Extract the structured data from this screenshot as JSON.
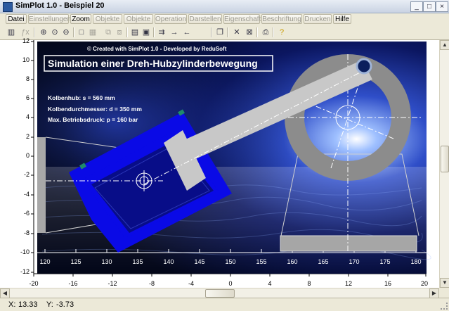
{
  "window": {
    "title": "SimPlot 1.0 - Beispiel 20"
  },
  "menu": {
    "items": [
      {
        "label": "Datei",
        "enabled": true
      },
      {
        "label": "Einstellungen",
        "enabled": false
      },
      {
        "label": "Zoom",
        "enabled": true
      },
      {
        "label": "Objekte I",
        "enabled": false
      },
      {
        "label": "Objekte II",
        "enabled": false
      },
      {
        "label": "Operation",
        "enabled": false
      },
      {
        "label": "Darstellen",
        "enabled": false
      },
      {
        "label": "Eigenschaft",
        "enabled": false
      },
      {
        "label": "Beschriftung",
        "enabled": false
      },
      {
        "label": "Drucken",
        "enabled": false
      },
      {
        "label": "Hilfe",
        "enabled": true
      }
    ]
  },
  "toolbar": {
    "icons": [
      "calculator-icon",
      "function-icon",
      "zoom-in-icon",
      "zoom-area-icon",
      "zoom-out-icon",
      "rectangle-icon",
      "grid-icon",
      "copy-object-icon",
      "paste-object-icon",
      "table-icon",
      "image-icon",
      "export-icon",
      "arrow-right-icon",
      "arrow-left-icon",
      "pages-icon",
      "delete-icon",
      "delete-all-icon",
      "print-icon",
      "help-icon"
    ]
  },
  "plot": {
    "y_ticks": [
      "12",
      "10",
      "8",
      "6",
      "4",
      "2",
      "0",
      "-2",
      "-4",
      "-6",
      "-8",
      "-10",
      "-12"
    ],
    "x_ticks": [
      "-20",
      "-16",
      "-12",
      "-8",
      "-4",
      "0",
      "4",
      "8",
      "12",
      "16",
      "20"
    ],
    "inner_x_ticks": [
      "120",
      "125",
      "130",
      "135",
      "140",
      "145",
      "150",
      "155",
      "160",
      "165",
      "170",
      "175",
      "180"
    ],
    "credit": "© Created with SimPlot 1.0 - Developed by ReduSoft",
    "heading": "Simulation einer Dreh-Hubzylinderbewegung",
    "specs": [
      "Kolbenhub: s = 560 mm",
      "Kolbendurchmesser: d = 350 mm",
      "Max. Betriebsdruck: p = 160 bar"
    ],
    "colors": {
      "cylinder": "#0a0ae6",
      "piston": "#c8c8c8",
      "wheel": "#8c8c8c",
      "background_dark": "#02081f",
      "background_glow": "#5f8cff"
    }
  },
  "status": {
    "x_label": "X:",
    "x_value": "13.33",
    "y_label": "Y:",
    "y_value": "-3.73"
  }
}
